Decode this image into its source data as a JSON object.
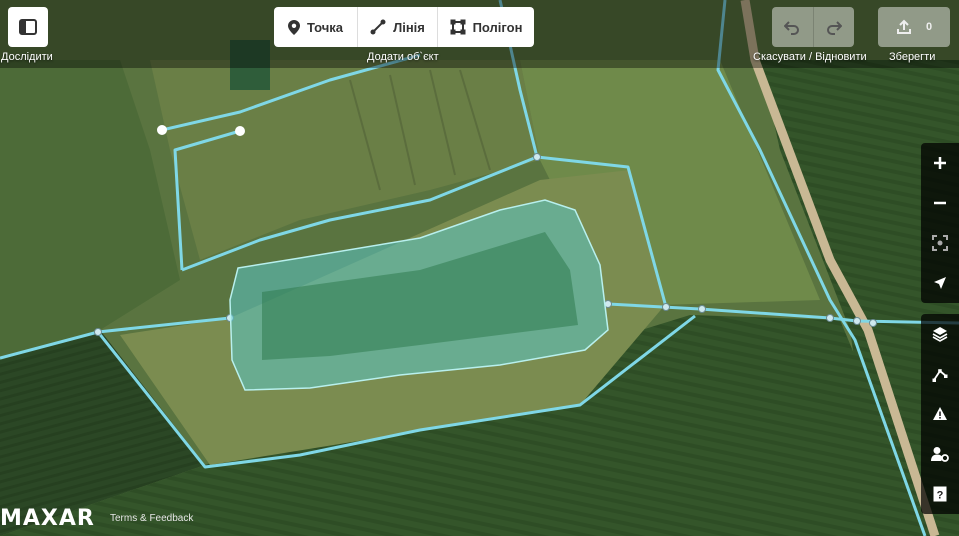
{
  "toolbar": {
    "explore_label": "Дослідити",
    "add_feature_label": "Додати об`єкт",
    "point_label": "Точка",
    "line_label": "Лінія",
    "polygon_label": "Полігон",
    "undo_redo_label": "Скасувати / Відновити",
    "save_label": "Зберегти",
    "save_count": "0"
  },
  "map_controls": [
    "zoom-in-icon",
    "zoom-out-icon",
    "zoom-to-selection-icon",
    "geolocate-icon"
  ],
  "map_panels": [
    "layers-icon",
    "map-data-icon",
    "issues-icon",
    "preferences-icon",
    "help-icon"
  ],
  "attribution": {
    "logo": "MAXAR",
    "terms_link": "Terms & Feedback"
  },
  "colors": {
    "road_highlight": "#7fd7e6",
    "water_area": "#5bc7c4"
  }
}
